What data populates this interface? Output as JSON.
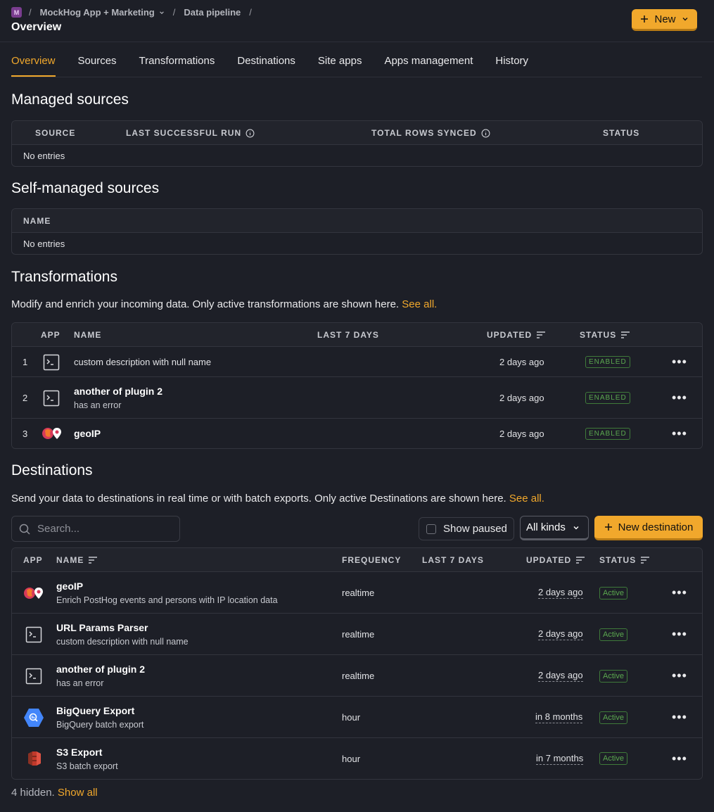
{
  "header": {
    "project_initial": "M",
    "project": "MockHog App + Marketing",
    "crumb": "Data pipeline",
    "title": "Overview",
    "new_label": "New"
  },
  "tabs": [
    "Overview",
    "Sources",
    "Transformations",
    "Destinations",
    "Site apps",
    "Apps management",
    "History"
  ],
  "managed": {
    "title": "Managed sources",
    "columns": [
      "SOURCE",
      "LAST SUCCESSFUL RUN",
      "TOTAL ROWS SYNCED",
      "STATUS"
    ],
    "empty": "No entries"
  },
  "selfmanaged": {
    "title": "Self-managed sources",
    "columns": [
      "NAME"
    ],
    "empty": "No entries"
  },
  "transformations": {
    "title": "Transformations",
    "desc": "Modify and enrich your incoming data. Only active transformations are shown here.",
    "see_all": "See all.",
    "columns": [
      "APP",
      "NAME",
      "LAST 7 DAYS",
      "UPDATED",
      "STATUS"
    ],
    "rows": [
      {
        "idx": "1",
        "icon": "terminal-icon",
        "name": "",
        "desc": "custom description with null name",
        "updated": "2 days ago",
        "status": "ENABLED"
      },
      {
        "idx": "2",
        "icon": "terminal-icon",
        "name": "another of plugin 2",
        "desc": "has an error",
        "updated": "2 days ago",
        "status": "ENABLED"
      },
      {
        "idx": "3",
        "icon": "geoip-icon",
        "name": "geoIP",
        "desc": "",
        "updated": "2 days ago",
        "status": "ENABLED"
      }
    ]
  },
  "destinations": {
    "title": "Destinations",
    "desc": "Send your data to destinations in real time or with batch exports. Only active Destinations are shown here.",
    "see_all": "See all.",
    "search_placeholder": "Search...",
    "show_paused": "Show paused",
    "kinds": "All kinds",
    "new_destination": "New destination",
    "columns": [
      "APP",
      "NAME",
      "FREQUENCY",
      "LAST 7 DAYS",
      "UPDATED",
      "STATUS"
    ],
    "rows": [
      {
        "icon": "geoip-icon",
        "name": "geoIP",
        "desc": "Enrich PostHog events and persons with IP location data",
        "frequency": "realtime",
        "updated": "2 days ago",
        "status": "Active"
      },
      {
        "icon": "terminal-icon",
        "name": "URL Params Parser",
        "desc": "custom description with null name",
        "frequency": "realtime",
        "updated": "2 days ago",
        "status": "Active"
      },
      {
        "icon": "terminal-icon",
        "name": "another of plugin 2",
        "desc": "has an error",
        "frequency": "realtime",
        "updated": "2 days ago",
        "status": "Active"
      },
      {
        "icon": "bigquery-icon",
        "name": "BigQuery Export",
        "desc": "BigQuery batch export",
        "frequency": "hour",
        "updated": "in 8 months",
        "status": "Active"
      },
      {
        "icon": "s3-icon",
        "name": "S3 Export",
        "desc": "S3 batch export",
        "frequency": "hour",
        "updated": "in 7 months",
        "status": "Active"
      }
    ],
    "hidden_text": "4 hidden.",
    "show_all": "Show all"
  },
  "colors": {
    "accent": "#f1a82c",
    "success": "#5ba84f",
    "background": "#1d1f27"
  }
}
